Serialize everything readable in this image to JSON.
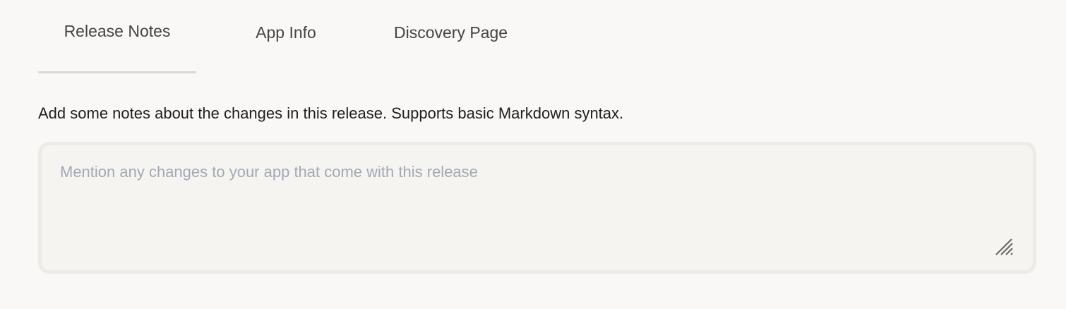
{
  "tabs": [
    {
      "label": "Release Notes",
      "active": true
    },
    {
      "label": "App Info",
      "active": false
    },
    {
      "label": "Discovery Page",
      "active": false
    }
  ],
  "description": "Add some notes about the changes in this release. Supports basic Markdown syntax.",
  "release_notes": {
    "value": "",
    "placeholder": "Mention any changes to your app that come with this release"
  },
  "icons": {
    "resize": "resize-grip-icon"
  }
}
